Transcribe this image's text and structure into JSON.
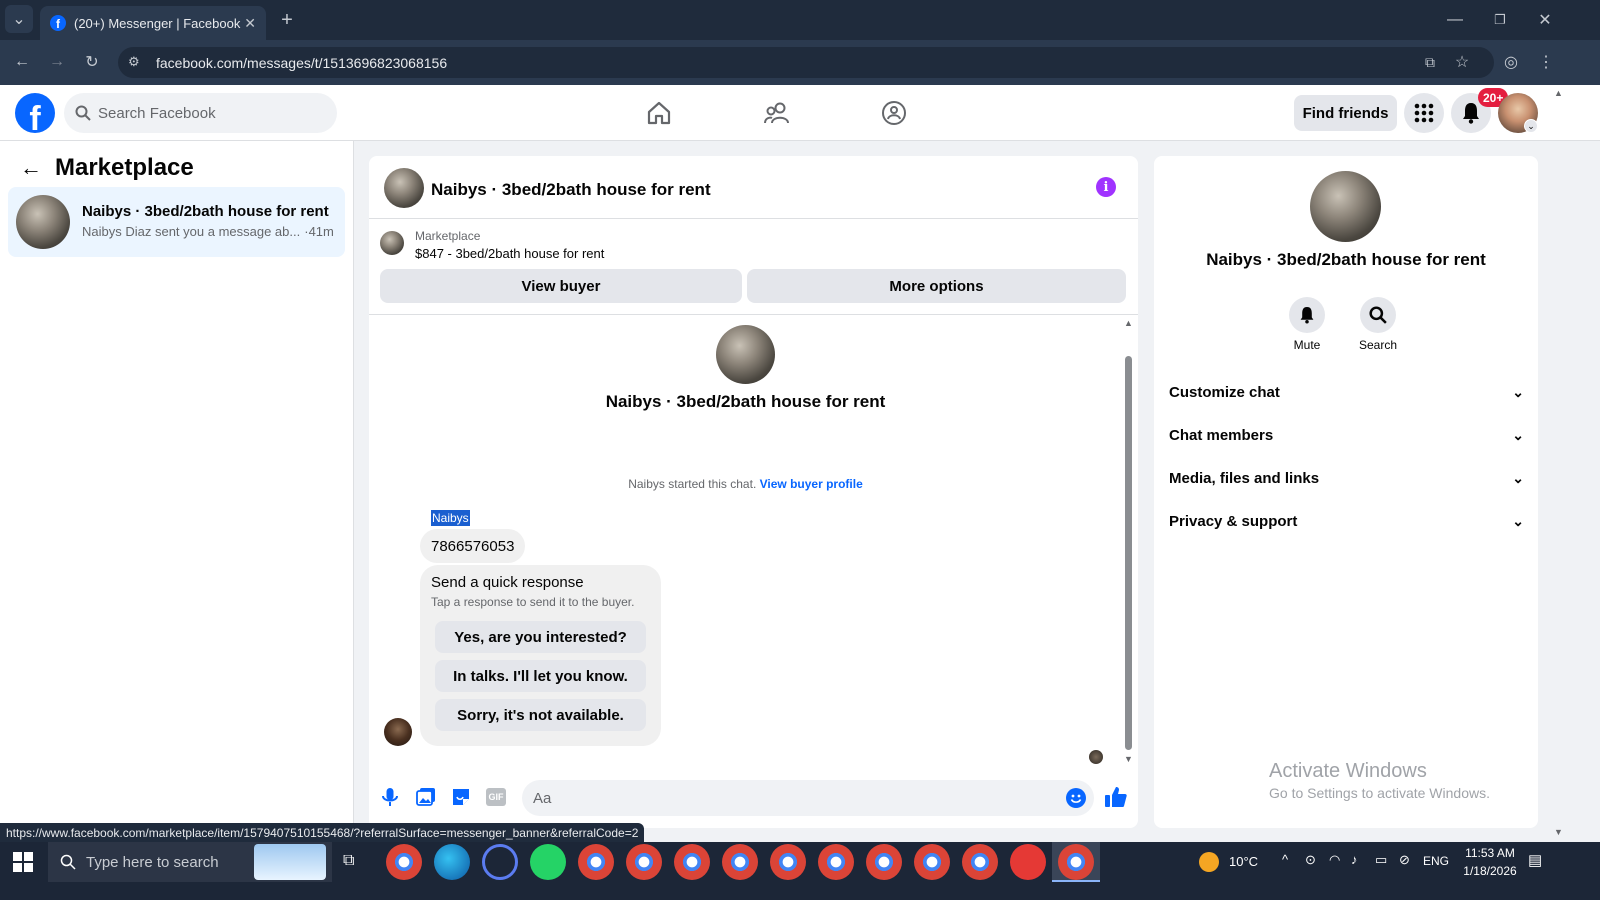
{
  "browser": {
    "tab_title": "(20+) Messenger | Facebook",
    "url": "facebook.com/messages/t/1513696823068156",
    "status_url": "https://www.facebook.com/marketplace/item/1579407510155468/?referralSurface=messenger_banner&referralCode=2"
  },
  "header": {
    "search_placeholder": "Search Facebook",
    "find_friends": "Find friends",
    "notif_badge": "20+"
  },
  "left": {
    "title": "Marketplace",
    "conversation": {
      "name": "Naibys · 3bed/2bath house for rent",
      "preview": "Naibys Diaz sent you a message ab...",
      "time": "·41m"
    }
  },
  "chat": {
    "title": "Naibys · 3bed/2bath house for rent",
    "banner_label": "Marketplace",
    "banner_item": "$847 - 3bed/2bath house for rent",
    "view_buyer": "View buyer",
    "more_options": "More options",
    "profile_name": "Naibys · 3bed/2bath house for rent",
    "started_text": "Naibys started this chat.",
    "view_buyer_profile": "View buyer profile",
    "sender": "Naibys",
    "message": "7866576053",
    "quick_title": "Send a quick response",
    "quick_sub": "Tap a response to send it to the buyer.",
    "quick_options": [
      "Yes, are you interested?",
      "In talks. I'll let you know.",
      "Sorry, it's not available."
    ],
    "composer_placeholder": "Aa"
  },
  "right": {
    "name": "Naibys · 3bed/2bath house for rent",
    "mute": "Mute",
    "search": "Search",
    "sections": [
      "Customize chat",
      "Chat members",
      "Media, files and links",
      "Privacy & support"
    ],
    "watermark_title": "Activate Windows",
    "watermark_sub": "Go to Settings to activate Windows."
  },
  "taskbar": {
    "search_placeholder": "Type here to search",
    "weather": "10°C",
    "lang": "ENG",
    "time": "11:53 AM",
    "date": "1/18/2026"
  },
  "colors": {
    "fb_blue": "#0866ff",
    "messenger_purple": "#a033ff",
    "notif_red": "#e41e3f"
  }
}
